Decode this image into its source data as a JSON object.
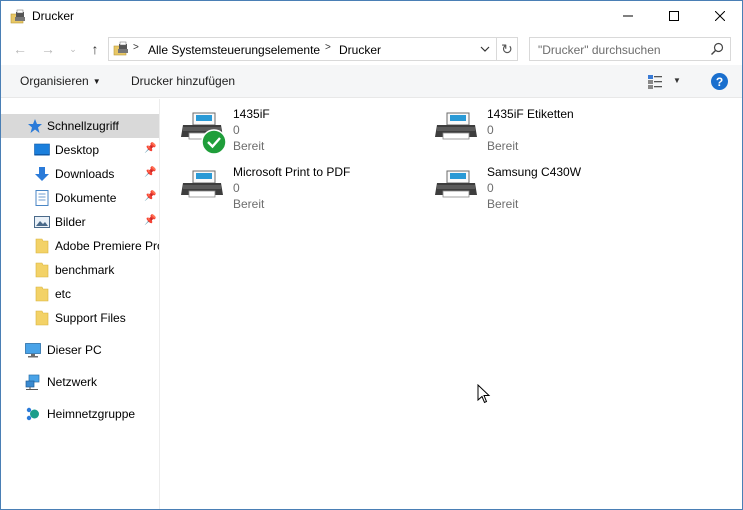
{
  "window": {
    "title": "Drucker"
  },
  "address": {
    "segments": [
      "Alle Systemsteuerungselemente",
      "Drucker"
    ],
    "separator": ">"
  },
  "search": {
    "placeholder": "\"Drucker\" durchsuchen"
  },
  "commandbar": {
    "organize_label": "Organisieren",
    "add_printer_label": "Drucker hinzufügen",
    "help_label": "?"
  },
  "sidebar": {
    "quick_access": "Schnellzugriff",
    "items": [
      {
        "label": "Desktop",
        "icon": "desktop-icon",
        "pinned": true
      },
      {
        "label": "Downloads",
        "icon": "downloads-icon",
        "pinned": true
      },
      {
        "label": "Dokumente",
        "icon": "documents-icon",
        "pinned": true
      },
      {
        "label": "Bilder",
        "icon": "pictures-icon",
        "pinned": true
      },
      {
        "label": "Adobe Premiere Pro",
        "icon": "folder-icon",
        "pinned": false
      },
      {
        "label": "benchmark",
        "icon": "folder-icon",
        "pinned": false
      },
      {
        "label": "etc",
        "icon": "folder-icon",
        "pinned": false
      },
      {
        "label": "Support Files",
        "icon": "folder-icon",
        "pinned": false
      }
    ],
    "this_pc": "Dieser PC",
    "network": "Netzwerk",
    "homegroup": "Heimnetzgruppe"
  },
  "printers": [
    {
      "name": "1435iF",
      "documents": "0",
      "status": "Bereit",
      "default": true
    },
    {
      "name": "1435iF Etiketten",
      "documents": "0",
      "status": "Bereit",
      "default": false
    },
    {
      "name": "Microsoft Print to PDF",
      "documents": "0",
      "status": "Bereit",
      "default": false
    },
    {
      "name": "Samsung C430W",
      "documents": "0",
      "status": "Bereit",
      "default": false
    }
  ],
  "colors": {
    "accent": "#1a6fce",
    "selection": "#d9d9d9",
    "default_check": "#1f9e3a",
    "folder": "#f3d267"
  }
}
